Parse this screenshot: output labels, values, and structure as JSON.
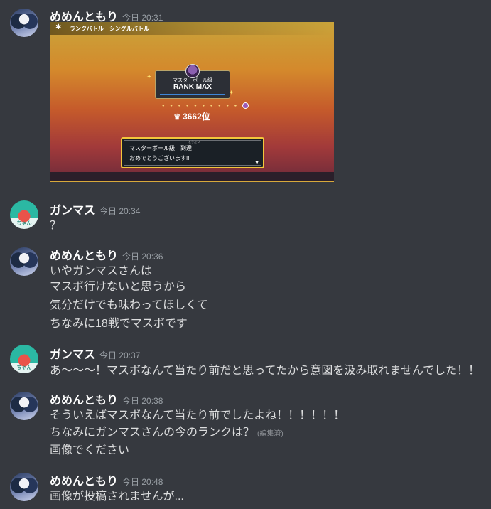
{
  "messages": [
    {
      "user": "めめんともり",
      "time": "今日 20:31",
      "avatar": "memento-avatar",
      "attachment": {
        "mode": "ランクバトル　シングルバトル",
        "tier": "マスターボール級",
        "rank": "RANK MAX",
        "place": "3662位",
        "dialog_line1": "マスターボール級　到達",
        "dialog_ruby": "とうたつ",
        "dialog_line2": "おめでとうございます!!",
        "accent": "#f3c63b"
      }
    },
    {
      "user": "ガンマス",
      "time": "今日 20:34",
      "avatar": "ganmasu-avatar",
      "avatar_text": "ちゃん",
      "lines": [
        "？"
      ]
    },
    {
      "user": "めめんともり",
      "time": "今日 20:36",
      "avatar": "memento-avatar",
      "lines": [
        "いやガンマスさんは",
        "マスボ行けないと思うから",
        "気分だけでも味わってほしくて",
        "ちなみに18戦でマスボです"
      ]
    },
    {
      "user": "ガンマス",
      "time": "今日 20:37",
      "avatar": "ganmasu-avatar",
      "avatar_text": "ちゃん",
      "lines": [
        "あ〜〜〜！マスボなんて当たり前だと思ってたから意図を汲み取れませんでした！！"
      ]
    },
    {
      "user": "めめんともり",
      "time": "今日 20:38",
      "avatar": "memento-avatar",
      "lines": [
        "そういえばマスボなんて当たり前でしたよね！！！！！！",
        "ちなみにガンマスさんの今のランクは？",
        "画像でください"
      ],
      "edited": "(編集済)"
    },
    {
      "user": "めめんともり",
      "time": "今日 20:48",
      "avatar": "memento-avatar",
      "lines": [
        "画像が投稿されませんが..."
      ]
    }
  ],
  "colors": {
    "background": "#36393f",
    "username": "#ffffff",
    "text": "#dcddde",
    "timestamp": "#9aa0a6"
  }
}
